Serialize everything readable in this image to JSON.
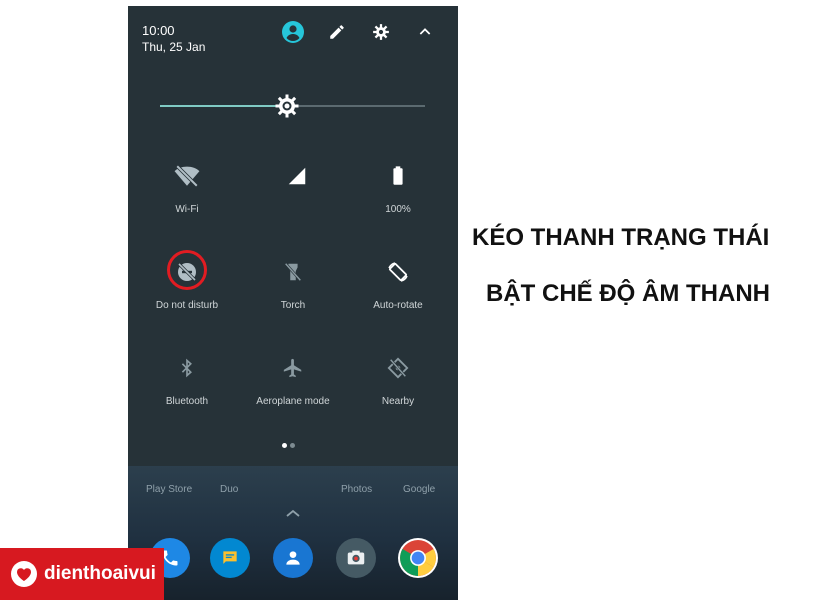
{
  "status": {
    "time": "10:00",
    "date": "Thu, 25 Jan"
  },
  "header_icons": [
    "account-icon",
    "edit-icon",
    "settings-icon",
    "collapse-chevron-icon"
  ],
  "brightness": {
    "level": 0.48
  },
  "tiles": [
    {
      "label": "Wi-Fi",
      "icon": "wifi-off-icon"
    },
    {
      "label": "",
      "icon": "cellular-signal-icon"
    },
    {
      "label": "100%",
      "icon": "battery-icon"
    },
    {
      "label": "Do not disturb",
      "icon": "do-not-disturb-icon"
    },
    {
      "label": "Torch",
      "icon": "torch-icon"
    },
    {
      "label": "Auto-rotate",
      "icon": "auto-rotate-icon"
    },
    {
      "label": "Bluetooth",
      "icon": "bluetooth-icon"
    },
    {
      "label": "Aeroplane mode",
      "icon": "aeroplane-icon"
    },
    {
      "label": "Nearby",
      "icon": "nearby-icon"
    }
  ],
  "page_indicator": {
    "pages": 2,
    "current": 1
  },
  "home": {
    "app_labels": [
      "Play Store",
      "Duo",
      "Photos",
      "Google"
    ],
    "dock": [
      "phone-icon",
      "messages-icon",
      "contacts-icon",
      "camera-icon",
      "chrome-icon"
    ]
  },
  "captions": {
    "line1": "KÉO THANH TRẠNG THÁI",
    "line2": "BẬT CHẾ ĐỘ ÂM THANH"
  },
  "logo": {
    "text": "dienthoaivui"
  },
  "colors": {
    "accent_teal": "#80cbc4",
    "highlight_red": "#e11c22",
    "brand_red": "#d71920",
    "shade_bg": "#263238"
  }
}
